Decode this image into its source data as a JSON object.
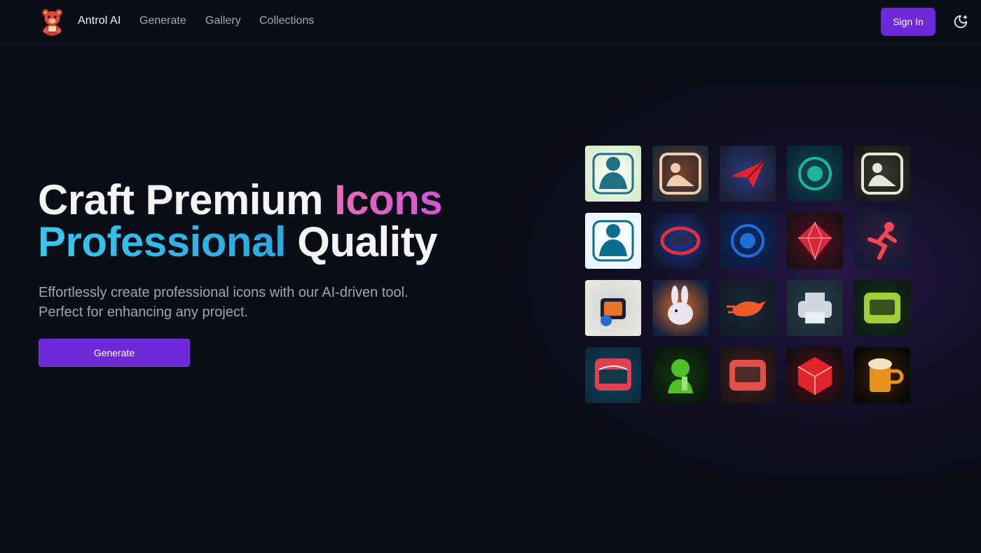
{
  "nav": {
    "brand": "Antrol AI",
    "links": [
      "Generate",
      "Gallery",
      "Collections"
    ],
    "sign_in": "Sign In"
  },
  "hero": {
    "title_line1_white": "Craft Premium ",
    "title_line1_accent": "Icons",
    "title_line2_accent": "Professional",
    "title_line2_white": " Quality",
    "subtitle": "Effortlessly create professional icons with our AI-driven tool. Perfect for enhancing any project.",
    "cta": "Generate"
  },
  "colors": {
    "background": "#0b0d17",
    "accent_purple": "#6d28d9",
    "gradient_pink": "#e86bb7",
    "gradient_cyan": "#39c7ee"
  },
  "gallery": [
    {
      "name": "woman-reading-icon",
      "bg": "#d6ecc9",
      "fg": "#1f6f86",
      "glow": "#ffffff",
      "shape": "person"
    },
    {
      "name": "person-relaxing-icon",
      "bg": "#1c2a34",
      "fg": "#f1cdb0",
      "glow": "#7a3e2a",
      "shape": "frame"
    },
    {
      "name": "paper-plane-icon",
      "bg": "#1b2036",
      "fg": "#e0252f",
      "glow": "#2a3a80",
      "shape": "plane"
    },
    {
      "name": "coin-icon",
      "bg": "#0b2432",
      "fg": "#1fb3a0",
      "glow": "#0f4a55",
      "shape": "circle"
    },
    {
      "name": "workers-table-icon",
      "bg": "#1a1a1a",
      "fg": "#e8e4d8",
      "glow": "#3a3a34",
      "shape": "frame"
    },
    {
      "name": "worker-tools-icon",
      "bg": "#e9f6fb",
      "fg": "#0a6f8f",
      "glow": "#ffffff",
      "shape": "person"
    },
    {
      "name": "keyboard-ring-icon",
      "bg": "#101426",
      "fg": "#e0303a",
      "glow": "#1a3a9a",
      "shape": "ring"
    },
    {
      "name": "orca-whale-icon",
      "bg": "#0e1a3a",
      "fg": "#1f6fd6",
      "glow": "#0a2a6a",
      "shape": "circle"
    },
    {
      "name": "ruby-gem-icon",
      "bg": "#1a1014",
      "fg": "#d22a3a",
      "glow": "#5a1020",
      "shape": "diamond"
    },
    {
      "name": "running-man-icon",
      "bg": "#121a32",
      "fg": "#f0484e",
      "glow": "#3a1a40",
      "shape": "runner"
    },
    {
      "name": "retro-tv-icon",
      "bg": "#e7e7e2",
      "fg": "#e8772a",
      "glow": "#cfcfcf",
      "shape": "tv"
    },
    {
      "name": "rabbit-icon",
      "bg": "#0e2040",
      "fg": "#e9e4ee",
      "glow": "#e06a20",
      "shape": "rabbit"
    },
    {
      "name": "speed-bird-icon",
      "bg": "#121a24",
      "fg": "#f05a28",
      "glow": "#1a2a3a",
      "shape": "bird"
    },
    {
      "name": "printer-icon",
      "bg": "#1a2a36",
      "fg": "#cfd8de",
      "glow": "#2a3e4c",
      "shape": "printer"
    },
    {
      "name": "terminal-card-icon",
      "bg": "#0e1a14",
      "fg": "#9fd03a",
      "glow": "#163a1a",
      "shape": "card"
    },
    {
      "name": "bridge-icon",
      "bg": "#0e2a3a",
      "fg": "#e04050",
      "glow": "#0a4a6a",
      "shape": "bridge"
    },
    {
      "name": "zombie-drinking-icon",
      "bg": "#0a160c",
      "fg": "#4fc02a",
      "glow": "#123a12",
      "shape": "zombie"
    },
    {
      "name": "frog-badge-icon",
      "bg": "#1a1416",
      "fg": "#e05048",
      "glow": "#4a2020",
      "shape": "card"
    },
    {
      "name": "red-cube-icon",
      "bg": "#140e12",
      "fg": "#e0242a",
      "glow": "#5a0e14",
      "shape": "cube"
    },
    {
      "name": "beer-mug-icon",
      "bg": "#080808",
      "fg": "#e6921c",
      "glow": "#402208",
      "shape": "mug"
    }
  ]
}
